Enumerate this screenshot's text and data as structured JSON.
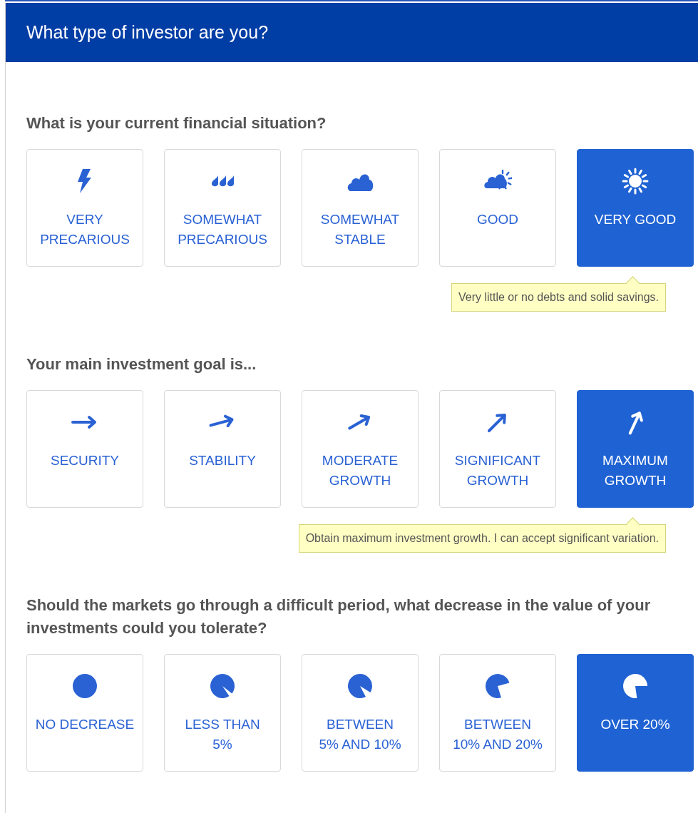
{
  "header": {
    "title": "What type of investor are you?"
  },
  "questions": [
    {
      "text": "What is your current financial situation?",
      "hint": "Very little or no debts and solid savings.",
      "options": [
        {
          "label": "VERY\nPRECARIOUS",
          "kind": "bolt",
          "selected": false
        },
        {
          "label": "SOMEWHAT\nPRECARIOUS",
          "kind": "drops",
          "selected": false
        },
        {
          "label": "SOMEWHAT\nSTABLE",
          "kind": "cloud",
          "selected": false
        },
        {
          "label": "GOOD",
          "kind": "suncloud",
          "selected": false
        },
        {
          "label": "VERY GOOD",
          "kind": "sun",
          "selected": true
        }
      ]
    },
    {
      "text": "Your main investment goal is...",
      "hint": "Obtain maximum investment growth. I can accept significant variation.",
      "options": [
        {
          "label": "SECURITY",
          "kind": "arrow1",
          "selected": false
        },
        {
          "label": "STABILITY",
          "kind": "arrow2",
          "selected": false
        },
        {
          "label": "MODERATE\nGROWTH",
          "kind": "arrow3",
          "selected": false
        },
        {
          "label": "SIGNIFICANT\nGROWTH",
          "kind": "arrow4",
          "selected": false
        },
        {
          "label": "MAXIMUM\nGROWTH",
          "kind": "arrow5",
          "selected": true
        }
      ]
    },
    {
      "text": "Should the markets go through a difficult period, what decrease in the value of your investments could you tolerate?",
      "options": [
        {
          "label": "NO DECREASE",
          "kind": "pie0",
          "selected": false
        },
        {
          "label": "LESS THAN\n5%",
          "kind": "pie1",
          "selected": false
        },
        {
          "label": "BETWEEN\n5% AND 10%",
          "kind": "pie2",
          "selected": false
        },
        {
          "label": "BETWEEN\n10% AND 20%",
          "kind": "pie3",
          "selected": false
        },
        {
          "label": "OVER 20%",
          "kind": "pie4",
          "selected": true
        }
      ]
    }
  ]
}
